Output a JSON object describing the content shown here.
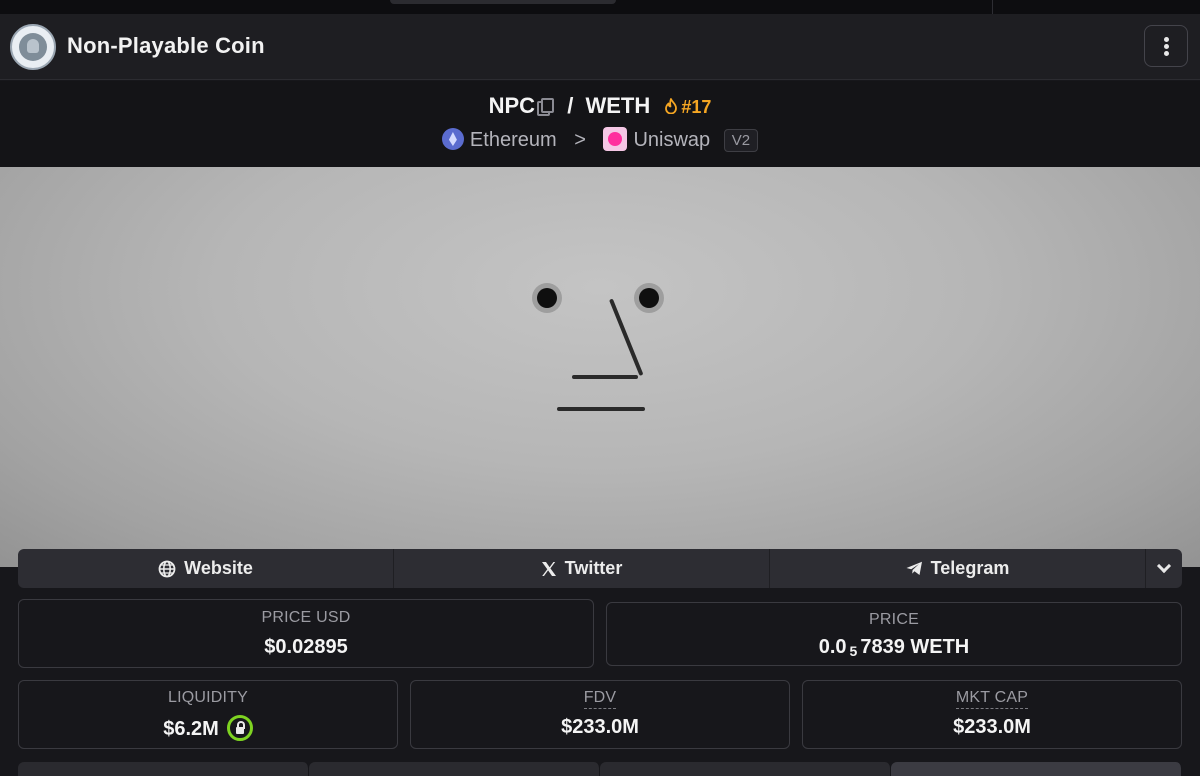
{
  "header": {
    "coin_name": "Non-Playable Coin",
    "logo_icon": "npc-coin-logo",
    "menu_icon": "kebab-menu-icon"
  },
  "pair": {
    "base": "NPC",
    "separator": "/",
    "quote": "WETH",
    "rank": "#17",
    "chain": "Ethereum",
    "chain_separator": ">",
    "dex": "Uniswap",
    "version": "V2"
  },
  "links": {
    "website": "Website",
    "twitter": "Twitter",
    "telegram": "Telegram"
  },
  "stats": {
    "price_usd_label": "PRICE USD",
    "price_usd_value": "$0.02895",
    "price_label": "PRICE",
    "price_prefix": "0.0",
    "price_zero_count": "5",
    "price_digits": "7839 WETH",
    "liquidity_label": "LIQUIDITY",
    "liquidity_value": "$6.2M",
    "fdv_label": "FDV",
    "fdv_value": "$233.0M",
    "mktcap_label": "MKT CAP",
    "mktcap_value": "$233.0M"
  },
  "colors": {
    "accent_rank": "#f5a623",
    "lock_green": "#7ed321",
    "background": "#17171b"
  }
}
